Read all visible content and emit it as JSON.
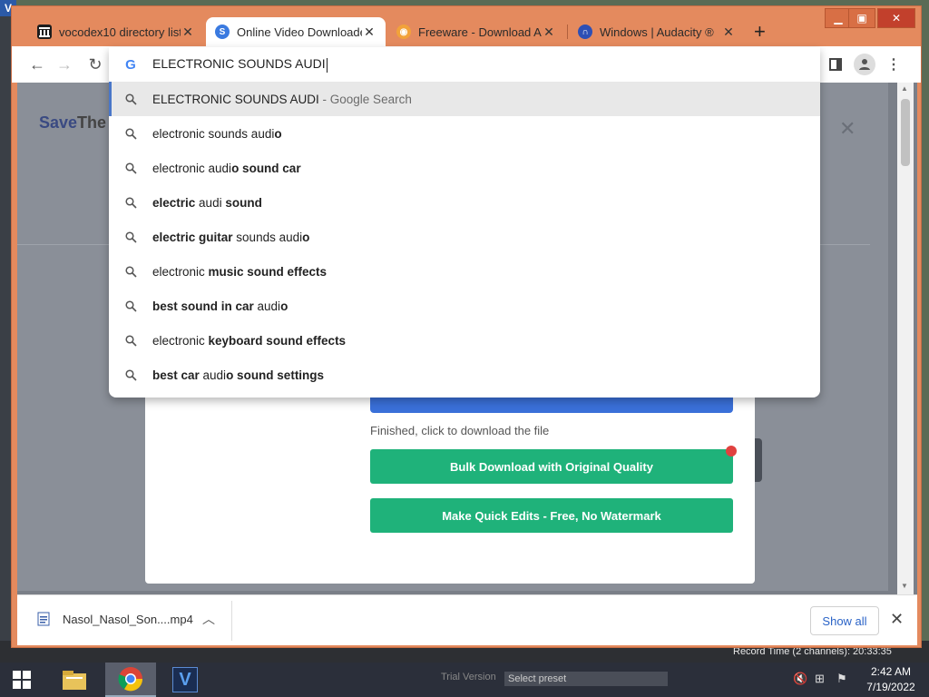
{
  "tabs": [
    {
      "title": "vocodex10 directory listi",
      "favicon": "library-icon"
    },
    {
      "title": "Online Video Downloade",
      "favicon": "s-circle-icon"
    },
    {
      "title": "Freeware - Download Ar",
      "favicon": "orange-swirl-icon"
    },
    {
      "title": "Windows | Audacity ®",
      "favicon": "headphones-icon"
    }
  ],
  "omnibox": {
    "query": "ELECTRONIC SOUNDS AUDI",
    "suggestions": [
      {
        "parts": [
          {
            "t": "ELECTRONIC SOUNDS AUDI",
            "b": false
          },
          {
            "t": " - Google Search",
            "hint": true
          }
        ]
      },
      {
        "parts": [
          {
            "t": "electronic sounds audi",
            "b": false
          },
          {
            "t": "o",
            "b": true
          }
        ]
      },
      {
        "parts": [
          {
            "t": "electronic audi",
            "b": false
          },
          {
            "t": "o sound car",
            "b": true
          }
        ]
      },
      {
        "parts": [
          {
            "t": "electric",
            "b": true
          },
          {
            "t": " audi ",
            "b": false
          },
          {
            "t": "sound",
            "b": true
          }
        ]
      },
      {
        "parts": [
          {
            "t": "electric guitar",
            "b": true
          },
          {
            "t": " sounds audi",
            "b": false
          },
          {
            "t": "o",
            "b": true
          }
        ]
      },
      {
        "parts": [
          {
            "t": "electronic ",
            "b": false
          },
          {
            "t": "music sound effects",
            "b": true
          }
        ]
      },
      {
        "parts": [
          {
            "t": "best sound in car",
            "b": true
          },
          {
            "t": " audi",
            "b": false
          },
          {
            "t": "o",
            "b": true
          }
        ]
      },
      {
        "parts": [
          {
            "t": "electronic ",
            "b": false
          },
          {
            "t": "keyboard sound effects",
            "b": true
          }
        ]
      },
      {
        "parts": [
          {
            "t": "best car",
            "b": true
          },
          {
            "t": " audi",
            "b": false
          },
          {
            "t": "o sound settings",
            "b": true
          }
        ]
      }
    ]
  },
  "page": {
    "brand_a": "Save",
    "brand_b": "The",
    "status_msg": "Finished, click to download the file",
    "bulk_button": "Bulk Download with Original Quality",
    "edit_button": "Make Quick Edits - Free, No Watermark"
  },
  "downloads": {
    "filename": "Nasol_Nasol_Son....mp4",
    "show_all": "Show all"
  },
  "taskbar": {
    "record_time": "Record Time (2 channels): 20:33:35",
    "trial": "Trial Version",
    "preset": "Select preset",
    "time": "2:42 AM",
    "date": "7/19/2022"
  },
  "colors": {
    "titlebar": "#e48a5e",
    "accent_green": "#1fb27a",
    "accent_blue": "#3a70d9"
  }
}
